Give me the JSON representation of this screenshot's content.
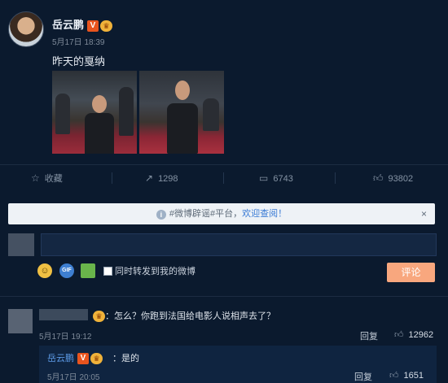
{
  "post": {
    "author": "岳云鹏",
    "verified_badge": "V",
    "crown_badge": "♛",
    "time": "5月17日 18:39",
    "text": "昨天的戛纳"
  },
  "actions": [
    {
      "label": "收藏",
      "icon": "star-icon"
    },
    {
      "label": "1298",
      "icon": "share-icon"
    },
    {
      "label": "6743",
      "icon": "comment-icon"
    },
    {
      "label": "93802",
      "icon": "thumbs-up-icon"
    }
  ],
  "notice": {
    "prefix": "#微博辟谣#平台，",
    "link": "欢迎查阅！",
    "close": "×"
  },
  "composer": {
    "emoji_icon": "☺",
    "gif_icon": "GIF",
    "image_icon": "image-icon",
    "repost_label": "同时转发到我的微博",
    "submit_label": "评论"
  },
  "comments": [
    {
      "text": "：怎么？你跑到法国给电影人说相声去了？",
      "time": "5月17日 19:12",
      "reply_label": "回复",
      "likes": "12962",
      "reply": {
        "author": "岳云鹏",
        "text": "：是的",
        "time": "5月17日 20:05",
        "reply_label": "回复",
        "likes": "1651"
      }
    }
  ],
  "colors": {
    "background": "#0b1a2e",
    "accent": "#5c9ae6",
    "submit": "#f8a77e",
    "verified": "#e8541e"
  }
}
